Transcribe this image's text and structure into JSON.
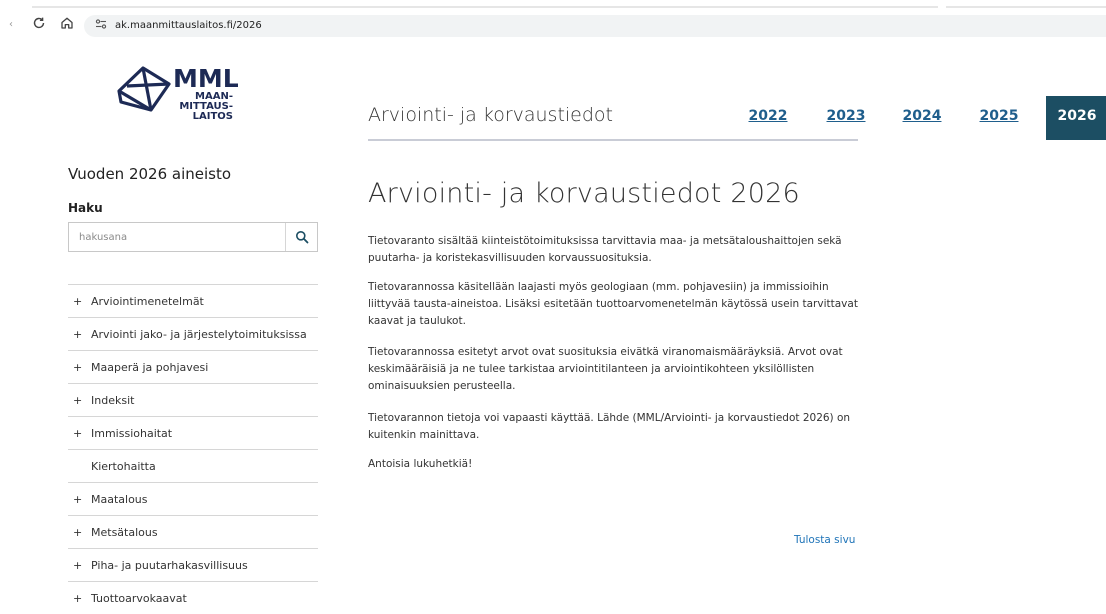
{
  "browser": {
    "url": "ak.maanmittauslaitos.fi/2026",
    "icons": {
      "reload": "reload-icon",
      "home": "home-icon",
      "site_info": "site-info-icon"
    }
  },
  "logo": {
    "main": "MML",
    "line1": "MAAN-",
    "line2": "MITTAUS-",
    "line3": "LAITOS"
  },
  "header": {
    "site_title": "Arviointi- ja korvaustiedot",
    "years": [
      "2022",
      "2023",
      "2024",
      "2025",
      "2026"
    ],
    "active_year": "2026"
  },
  "sidebar": {
    "heading": "Vuoden 2026 aineisto",
    "search_label": "Haku",
    "search_placeholder": "hakusana",
    "items": [
      {
        "label": "Arviointimenetelmät",
        "expandable": true
      },
      {
        "label": "Arviointi jako- ja järjestelytoimituksissa",
        "expandable": true
      },
      {
        "label": "Maaperä ja pohjavesi",
        "expandable": true
      },
      {
        "label": "Indeksit",
        "expandable": true
      },
      {
        "label": "Immissiohaitat",
        "expandable": true
      },
      {
        "label": "Kiertohaitta",
        "expandable": false
      },
      {
        "label": "Maatalous",
        "expandable": true
      },
      {
        "label": "Metsätalous",
        "expandable": true
      },
      {
        "label": "Piha- ja puutarhakasvillisuus",
        "expandable": true
      },
      {
        "label": "Tuottoarvokaavat",
        "expandable": true
      }
    ]
  },
  "main": {
    "title": "Arviointi- ja korvaustiedot 2026",
    "paragraphs": [
      "Tietovaranto sisältää kiinteistötoimituksissa tarvittavia maa- ja metsätaloushaittojen sekä puutarha- ja koristekasvillisuuden korvaussuosituksia.",
      "Tietovarannossa käsitellään laajasti myös geologiaan (mm. pohjavesiin) ja immissioihin liittyvää tausta-aineistoa. Lisäksi esitetään tuottoarvomenetelmän käytössä usein tarvittavat kaavat ja taulukot.",
      "Tietovarannossa esitetyt arvot ovat suosituksia eivätkä viranomaismääräyksiä. Arvot ovat keskimääräisiä ja ne tulee tarkistaa arviointitilanteen ja arviointikohteen yksilöllisten ominaisuuksien perusteella.",
      "Tietovarannon tietoja voi vapaasti käyttää. Lähde (MML/Arviointi- ja korvaustiedot 2026) on kuitenkin mainittava.",
      "Antoisia lukuhetkiä!"
    ],
    "print_link": "Tulosta sivu"
  },
  "colors": {
    "brand_navy": "#1d2a55",
    "active_tab": "#1c4e63",
    "link": "#1f5e8c"
  }
}
